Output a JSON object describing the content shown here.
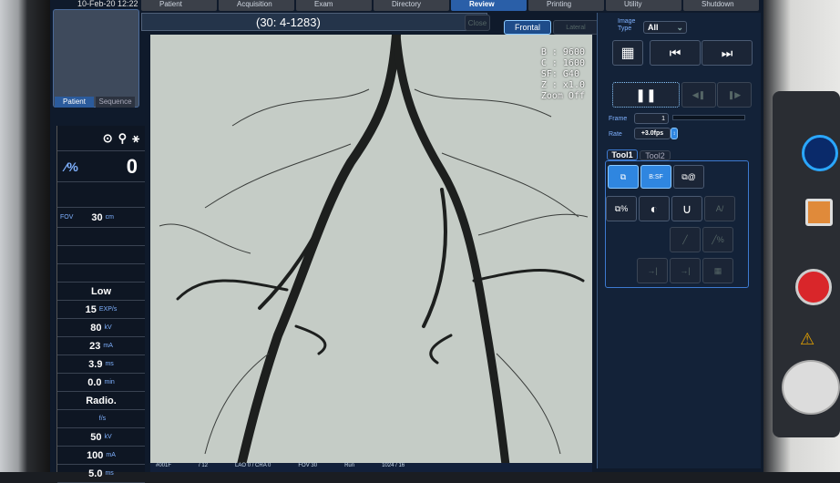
{
  "header": {
    "datetime": "10-Feb-20 12:22",
    "tabs": [
      {
        "label": "Patient"
      },
      {
        "label": "Acquisition"
      },
      {
        "label": "Exam"
      },
      {
        "label": "Directory"
      },
      {
        "label": "Review",
        "active": true
      },
      {
        "label": "Printing"
      },
      {
        "label": "Utility"
      },
      {
        "label": "Shutdown"
      }
    ]
  },
  "series_title": "(30: 4-1283)",
  "close_label": "Close",
  "view": {
    "frontal": "Frontal",
    "lateral": "Lateral"
  },
  "image_type": {
    "label": "Image Type",
    "value": "All"
  },
  "left": {
    "tabs": [
      "Patient",
      "Sequence"
    ],
    "counter": "0",
    "fov_label": "FOV",
    "fov_value": "30",
    "fov_unit": "cm",
    "fluoro": {
      "mode": "Low",
      "rows": [
        {
          "v": "15",
          "u": "EXP/s"
        },
        {
          "v": "80",
          "u": "kV"
        },
        {
          "v": "23",
          "u": "mA"
        },
        {
          "v": "3.9",
          "u": "ms"
        },
        {
          "v": "0.0",
          "u": "min"
        }
      ]
    },
    "radio": {
      "mode": "Radio.",
      "rows": [
        {
          "v": "",
          "u": "f/s"
        },
        {
          "v": "50",
          "u": "kV"
        },
        {
          "v": "100",
          "u": "mA"
        },
        {
          "v": "5.0",
          "u": "ms"
        }
      ]
    }
  },
  "overlay": {
    "b": "B : 9600",
    "c": "C : 1600",
    "sf": "SF: G40",
    "z": "Z : x1.0",
    "zoom": "Zoom Off"
  },
  "playback": {
    "frame_label": "Frame",
    "frame": "1",
    "rate_label": "Rate",
    "rate": "+3.0fps"
  },
  "tools": {
    "tabs": [
      "Tool1",
      "Tool2"
    ]
  },
  "status": {
    "frame": "#001F",
    "total": "/ 12",
    "angle": "LAO 0 / CRA 0",
    "fov": "FOV 30",
    "run": "Run",
    "matrix": "1024 / 16"
  },
  "colors": {
    "accent": "#2f86e0",
    "panel": "#132238"
  }
}
